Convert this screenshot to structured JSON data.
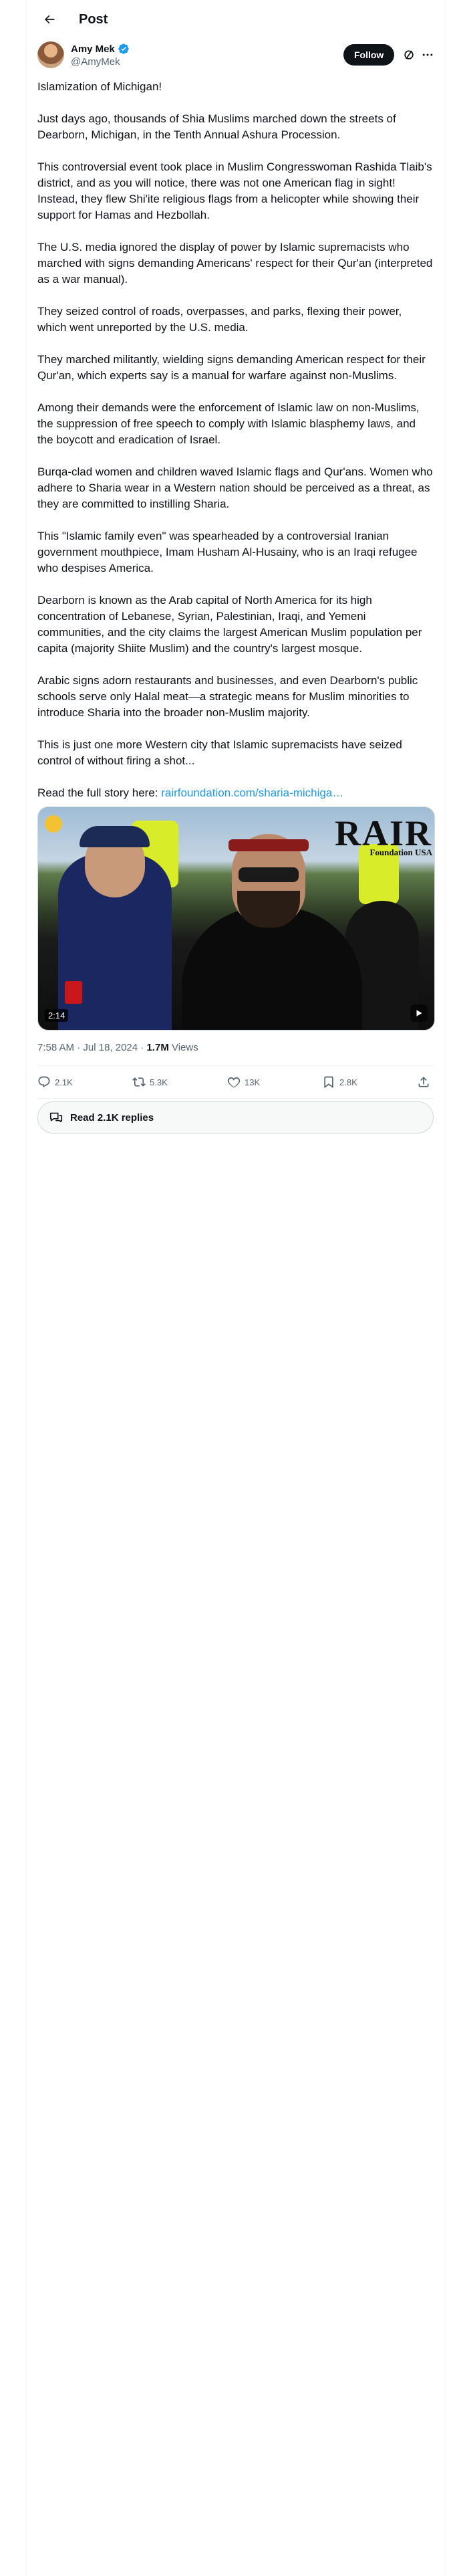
{
  "header": {
    "title": "Post"
  },
  "author": {
    "name": "Amy Mek",
    "handle": "@AmyMek",
    "follow_label": "Follow"
  },
  "tweet": {
    "paragraphs": [
      "Islamization of Michigan!",
      "Just days ago, thousands of Shia Muslims marched down the streets of Dearborn, Michigan, in the Tenth Annual Ashura Procession.",
      "This controversial event took place in Muslim Congresswoman Rashida Tlaib's district, and as you will notice, there was not one American flag in sight! Instead, they flew Shi'ite religious flags from a helicopter while showing their support for Hamas and Hezbollah.",
      "The U.S. media ignored the display of power by Islamic supremacists who marched with signs demanding Americans' respect for their Qur'an (interpreted as a war manual).",
      "They seized control of roads, overpasses, and parks, flexing their power, which went unreported by the U.S. media.",
      "They marched militantly, wielding signs demanding American respect for their Qur'an, which experts say is a manual for warfare against non-Muslims.",
      "Among their demands were the enforcement of Islamic law on non-Muslims, the suppression of free speech to comply with Islamic blasphemy laws, and the boycott and eradication of Israel.",
      "Burqa-clad women and children waved Islamic flags and Qur'ans. Women who adhere to Sharia wear in a Western nation should be perceived as a threat, as they are committed to instilling Sharia.",
      "This \"Islamic family even\" was spearheaded by a controversial Iranian government mouthpiece, Imam Husham Al-Husainy, who is an Iraqi refugee who despises America.",
      "Dearborn is known as the Arab capital of North America for its high concentration of Lebanese, Syrian, Palestinian, Iraqi, and Yemeni communities, and the city claims the largest American Muslim population per capita (majority Shiite Muslim) and the country's largest mosque.",
      "Arabic signs adorn restaurants and businesses, and even Dearborn's public schools serve only Halal meat—a strategic means for Muslim minorities to introduce Sharia into the broader non-Muslim majority.",
      "This is just one more Western city that Islamic supremacists have seized control of without firing a shot..."
    ],
    "read_more_prefix": "Read the full story here: ",
    "read_more_link": "rairfoundation.com/sharia-michiga…"
  },
  "media": {
    "logo_text": "RAIR",
    "logo_subtext": "Foundation USA",
    "duration": "2:14"
  },
  "meta": {
    "time": "7:58 AM",
    "separator1": " · ",
    "date": "Jul 18, 2024",
    "separator2": " · ",
    "views_count": "1.7M",
    "views_label": " Views"
  },
  "actions": {
    "replies": "2.1K",
    "reposts": "5.3K",
    "likes": "13K",
    "bookmarks": "2.8K"
  },
  "read_replies_label": "Read 2.1K replies",
  "colors": {
    "accent": "#1d9bf0",
    "text": "#0f1419",
    "muted": "#536471"
  },
  "icons": [
    "back-arrow-icon",
    "verified-icon",
    "grok-icon",
    "more-icon",
    "reply-icon",
    "repost-icon",
    "like-icon",
    "bookmark-icon",
    "share-icon",
    "chat-bubbles-icon"
  ]
}
